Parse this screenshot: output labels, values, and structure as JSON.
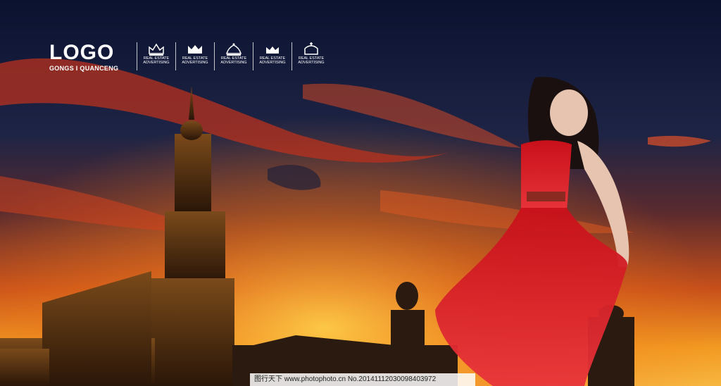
{
  "logo": {
    "title": "LOGO",
    "subtitle": "GONGS I QUANCENG"
  },
  "badges": [
    {
      "icon": "crown-icon",
      "line1": "REAL ESTATE",
      "line2": "ADVERTISING"
    },
    {
      "icon": "crown-icon",
      "line1": "REAL ESTATE",
      "line2": "ADVERTISING"
    },
    {
      "icon": "crown-icon",
      "line1": "REAL ESTATE",
      "line2": "ADVERTISING"
    },
    {
      "icon": "crown-icon",
      "line1": "REAL ESTATE",
      "line2": "ADVERTISING"
    },
    {
      "icon": "crown-icon",
      "line1": "REAL ESTATE",
      "line2": "ADVERTISING"
    }
  ],
  "watermark": {
    "text": "图行天下 www.photophoto.cn No.20141112030098403972"
  },
  "colors": {
    "sky_top": "#0b1230",
    "sky_glow": "#f08a1e",
    "dress": "#d8161c",
    "building": "#2a1a0e"
  }
}
